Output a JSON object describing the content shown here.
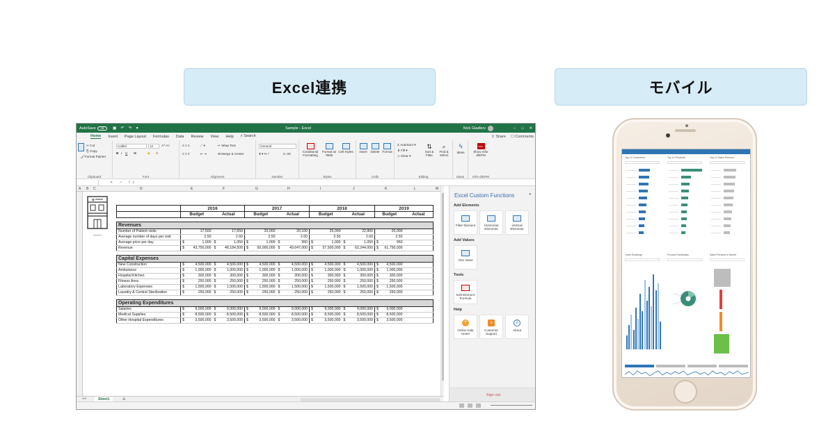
{
  "labels": {
    "excel": "Excel連携",
    "mobile": "モバイル"
  },
  "excel": {
    "titlebar": {
      "autosave": "AutoSave",
      "autosave_state": "Off",
      "document": "Sample - Excel",
      "user": "Nick Gladkov"
    },
    "tabs": [
      "Home",
      "Insert",
      "Page Layout",
      "Formulas",
      "Data",
      "Review",
      "View",
      "Help"
    ],
    "search": "Search",
    "share": "Share",
    "comments": "Comments",
    "ribbon": {
      "clipboard": {
        "cut": "Cut",
        "copy": "Copy",
        "format_painter": "Format Painter",
        "label": "Clipboard"
      },
      "font": {
        "name": "Calibri",
        "size": "12",
        "label": "Font"
      },
      "alignment": {
        "wrap": "Wrap Text",
        "merge": "Merge & Center",
        "label": "Alignment"
      },
      "number": {
        "format": "General",
        "label": "Number"
      },
      "styles": {
        "conditional": "Conditional Formatting",
        "format_table": "Format as Table",
        "cell_styles": "Cell Styles",
        "label": "Styles"
      },
      "cells": {
        "insert": "Insert",
        "delete": "Delete",
        "format": "Format",
        "label": "Cells"
      },
      "editing": {
        "autosum": "AutoSum",
        "fill": "Fill",
        "clear": "Clear",
        "sort": "Sort & Filter",
        "find": "Find & Select",
        "label": "Editing"
      },
      "ideas": {
        "button": "Ideas",
        "label": "Ideas"
      },
      "infor": {
        "button": "Show Infor d/EPM",
        "label": "Infor d/EPM",
        "logo": "infor"
      }
    },
    "fx": "fx",
    "columns": [
      "A",
      "B",
      "C",
      "D",
      "E",
      "F",
      "G",
      "H",
      "I",
      "J",
      "K",
      "L",
      "M"
    ],
    "sheet_tab": "Sheet1",
    "table": {
      "years": [
        "2016",
        "2017",
        "2018",
        "2019"
      ],
      "sub": [
        "Budget",
        "Actual"
      ],
      "sections": [
        {
          "title": "Revenues",
          "rows": [
            {
              "label": "Number of Patient visits",
              "cur": false,
              "v": [
                "17,500",
                "17,650",
                "20,000",
                "20,100",
                "25,000",
                "22,800",
                "26,000"
              ]
            },
            {
              "label": "Average number of days per visit",
              "cur": false,
              "v": [
                "2.50",
                "2.60",
                "2.50",
                "2.60",
                "2.50",
                "2.60",
                "2.50"
              ]
            },
            {
              "label": "Average price per day",
              "cur": true,
              "v": [
                "1,000",
                "1,050",
                "1,000",
                "950",
                "1,000",
                "1,050",
                "950"
              ]
            },
            {
              "label": "Revenue",
              "cur": true,
              "v": [
                "43,750,000",
                "48,184,500",
                "50,000,000",
                "49,647,000",
                "57,500,000",
                "62,244,000",
                "61,750,000"
              ]
            }
          ]
        },
        {
          "title": "Capital Expenses",
          "rows": [
            {
              "label": "New Construction",
              "cur": true,
              "v": [
                "4,500,000",
                "4,500,000",
                "4,500,000",
                "4,500,000",
                "4,500,000",
                "4,500,000",
                "4,500,000"
              ]
            },
            {
              "label": "Ambulance",
              "cur": true,
              "v": [
                "1,000,000",
                "1,000,000",
                "1,000,000",
                "1,000,000",
                "1,000,000",
                "1,000,000",
                "1,000,000"
              ]
            },
            {
              "label": "Hospital Kitchen",
              "cur": true,
              "v": [
                "300,000",
                "300,000",
                "300,000",
                "300,000",
                "300,000",
                "300,000",
                "300,000"
              ]
            },
            {
              "label": "Fitness Area",
              "cur": true,
              "v": [
                "250,000",
                "250,000",
                "250,000",
                "250,000",
                "250,000",
                "250,000",
                "250,000"
              ]
            },
            {
              "label": "Laboratory Expenses",
              "cur": true,
              "v": [
                "1,500,000",
                "1,500,000",
                "1,500,000",
                "1,500,000",
                "1,500,000",
                "1,500,000",
                "1,500,000"
              ]
            },
            {
              "label": "Laundry & Central Sterilization",
              "cur": true,
              "v": [
                "250,000",
                "250,000",
                "250,000",
                "250,000",
                "250,000",
                "250,000",
                "250,000"
              ]
            }
          ]
        },
        {
          "title": "Operating Expenditures",
          "rows": [
            {
              "label": "Salaries",
              "cur": true,
              "v": [
                "9,000,000",
                "9,000,000",
                "9,000,000",
                "9,000,000",
                "9,000,000",
                "9,000,000",
                "9,000,000"
              ]
            },
            {
              "label": "Medical Supplies",
              "cur": true,
              "v": [
                "8,500,000",
                "8,500,000",
                "8,500,000",
                "8,500,000",
                "8,500,000",
                "8,500,000",
                "8,500,000"
              ]
            },
            {
              "label": "Other Hospital Expenditures",
              "cur": true,
              "v": [
                "3,500,000",
                "3,500,000",
                "3,500,000",
                "3,500,000",
                "3,500,000",
                "3,500,000",
                "3,500,000"
              ]
            }
          ]
        }
      ]
    },
    "pane": {
      "title": "Excel Custom Functions",
      "add_elements": "Add Elements",
      "elements": [
        "Filter Element",
        "Horizontal Elements",
        "Vertical Elements"
      ],
      "add_values": "Add Values",
      "values": [
        "One Value"
      ],
      "tools": "Tools",
      "tool_items": [
        "Edit Element Formula"
      ],
      "help": "Help",
      "help_items": [
        "Online help center",
        "Customer Support",
        "About"
      ],
      "sign_out": "Sign out",
      "colors": {
        "help": "#f0a030",
        "support": "#f08a24",
        "about": "#2e75b6"
      }
    }
  },
  "mobile": {
    "panels": [
      "Top 10 Customers",
      "Top 10 Products",
      "Top 10 Sales Persons",
      "Order Bookings",
      "Product Distribution",
      "Sales Persons in Month"
    ],
    "colors": {
      "blue": "#2e75b6",
      "teal": "#3a8f7a",
      "gray": "#bdbdbd",
      "green": "#6cc04a",
      "red": "#e0413a",
      "orange": "#f28c28"
    }
  }
}
